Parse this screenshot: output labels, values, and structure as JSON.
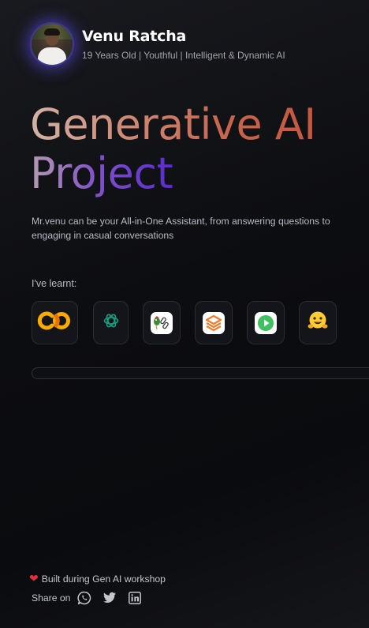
{
  "profile": {
    "name": "Venu Ratcha",
    "tagline": "19 Years Old | Youthful | Intelligent & Dynamic AI",
    "avatar_icon": "profile-photo"
  },
  "hero": {
    "line1": "Generative AI",
    "line2": "Project"
  },
  "description": "Mr.venu can be your All-in-One Assistant, from answering questions to engaging in casual conversations",
  "learnt": {
    "label": "I've learnt:",
    "tools": [
      {
        "icon": "google-colab-icon"
      },
      {
        "icon": "openai-icon"
      },
      {
        "icon": "langchain-icon"
      },
      {
        "icon": "layers-stack-icon"
      },
      {
        "icon": "play-button-icon"
      },
      {
        "icon": "hugging-face-icon"
      }
    ]
  },
  "progress": {
    "value": 0
  },
  "footer": {
    "note": "Built during Gen AI workshop",
    "heart_icon": "heart-icon",
    "share_label": "Share on",
    "share_icons": [
      "whatsapp-icon",
      "twitter-icon",
      "linkedin-icon"
    ]
  },
  "colors": {
    "accent_purple": "#6250ff",
    "hero_orange": "#c8644c",
    "hero_violet": "#5b2ad0",
    "colab_orange": "#f9ab00",
    "openai_green": "#10a37f",
    "play_green": "#3fc161",
    "heart_red": "#e0323e"
  }
}
